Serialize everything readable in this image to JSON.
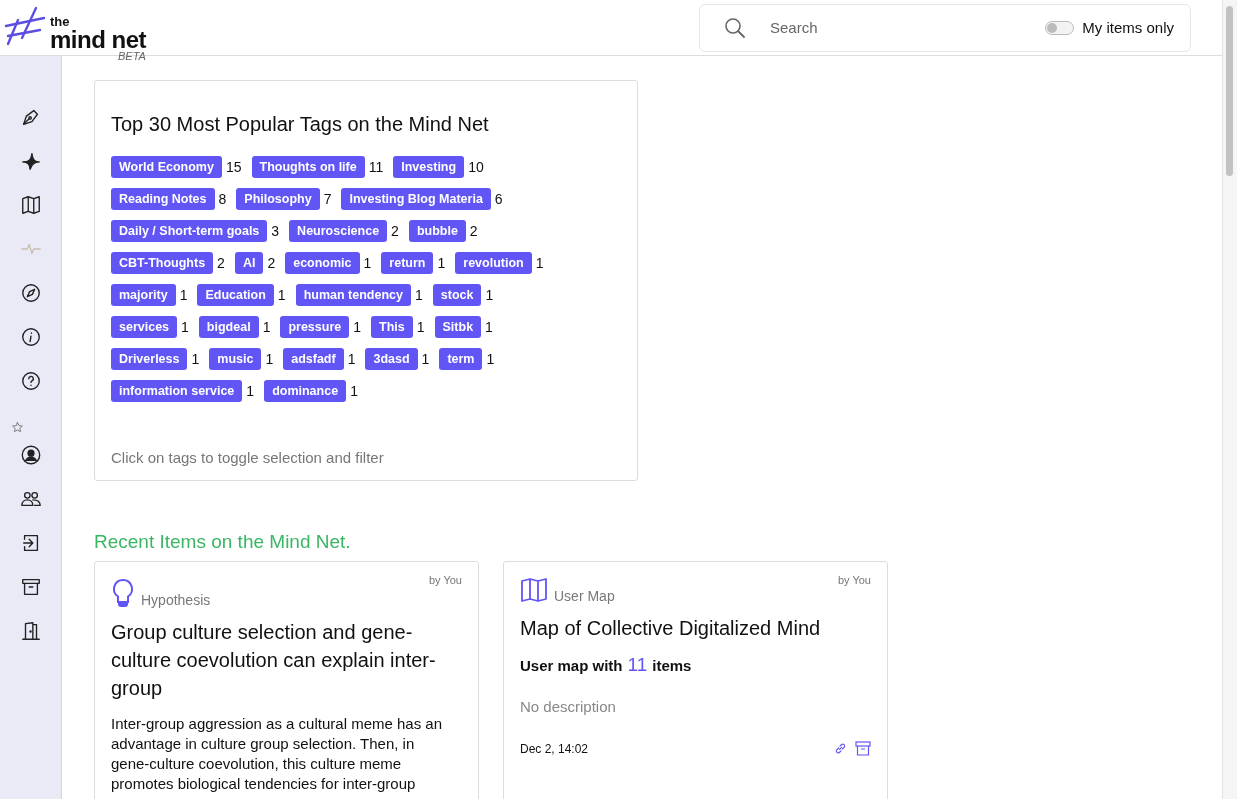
{
  "header": {
    "logo_small": "the",
    "logo_main": "mind net",
    "beta": "BETA",
    "search": {
      "placeholder": "Search"
    },
    "my_items_only": {
      "label": "My items only",
      "on": false
    }
  },
  "sidebar": {
    "items": [
      {
        "kind": "pen",
        "disabled": false
      },
      {
        "kind": "sparkle",
        "disabled": false
      },
      {
        "kind": "map",
        "disabled": false
      },
      {
        "kind": "pulse",
        "disabled": true
      },
      {
        "kind": "compass",
        "disabled": false
      },
      {
        "kind": "info",
        "disabled": false
      },
      {
        "kind": "help",
        "disabled": false
      },
      {
        "kind": "star",
        "disabled": false
      },
      {
        "kind": "user",
        "disabled": false
      },
      {
        "kind": "users",
        "disabled": false
      },
      {
        "kind": "login",
        "disabled": false
      },
      {
        "kind": "archive",
        "disabled": false
      },
      {
        "kind": "door",
        "disabled": false
      }
    ]
  },
  "tags_panel": {
    "title": "Top 30 Most Popular Tags on the Mind Net",
    "hint": "Click on tags to toggle selection and filter",
    "tags": [
      {
        "label": "World Economy",
        "count": "15"
      },
      {
        "label": "Thoughts on life",
        "count": "11"
      },
      {
        "label": "Investing",
        "count": "10"
      },
      {
        "label": "Reading Notes",
        "count": "8"
      },
      {
        "label": "Philosophy",
        "count": "7"
      },
      {
        "label": "Investing Blog Materia",
        "count": "6"
      },
      {
        "label": "Daily / Short-term goals",
        "count": "3"
      },
      {
        "label": "Neuroscience",
        "count": "2"
      },
      {
        "label": "bubble",
        "count": "2"
      },
      {
        "label": "CBT-Thoughts",
        "count": "2"
      },
      {
        "label": "AI",
        "count": "2"
      },
      {
        "label": "economic",
        "count": "1"
      },
      {
        "label": "return",
        "count": "1"
      },
      {
        "label": "revolution",
        "count": "1"
      },
      {
        "label": "majority",
        "count": "1"
      },
      {
        "label": "Education",
        "count": "1"
      },
      {
        "label": "human tendency",
        "count": "1"
      },
      {
        "label": "stock",
        "count": "1"
      },
      {
        "label": "services",
        "count": "1"
      },
      {
        "label": "bigdeal",
        "count": "1"
      },
      {
        "label": "pressure",
        "count": "1"
      },
      {
        "label": "This",
        "count": "1"
      },
      {
        "label": "Sitbk",
        "count": "1"
      },
      {
        "label": "Driverless",
        "count": "1"
      },
      {
        "label": "music",
        "count": "1"
      },
      {
        "label": "adsfadf",
        "count": "1"
      },
      {
        "label": "3dasd",
        "count": "1"
      },
      {
        "label": "term",
        "count": "1"
      },
      {
        "label": "information service",
        "count": "1"
      },
      {
        "label": "dominance",
        "count": "1"
      }
    ]
  },
  "recent": {
    "title": "Recent Items on the Mind Net.",
    "items": [
      {
        "kind": "hypothesis",
        "type_label": "Hypothesis",
        "author": "by You",
        "title": "Group culture selection and gene-culture coevolution can explain inter-group",
        "body": "Inter-group aggression as a cultural meme has an advantage in culture group selection. Then, in gene-culture coevolution, this culture meme promotes biological tendencies for inter-group"
      },
      {
        "kind": "map",
        "type_label": "User Map",
        "author": "by You",
        "title": "Map of Collective Digitalized Mind",
        "summary_prefix": "User map with",
        "summary_count": "11",
        "summary_suffix": "items",
        "description": "No description",
        "date": "Dec 2, 14:02"
      }
    ]
  }
}
